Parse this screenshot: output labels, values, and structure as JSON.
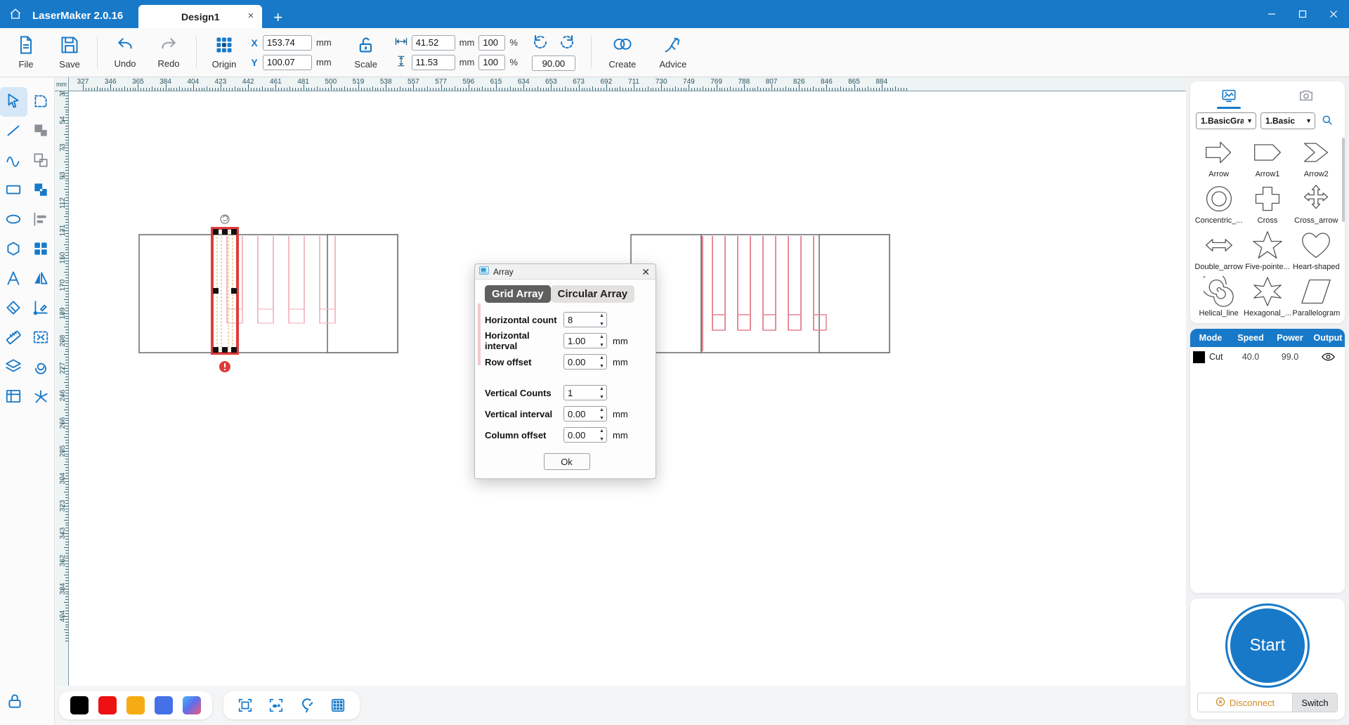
{
  "app": {
    "name": "LaserMaker 2.0.16",
    "home_icon": "home-icon",
    "tab": {
      "label": "Design1",
      "close": "×"
    },
    "new_tab": "+",
    "window": {
      "minimize": "─",
      "maximize": "☐",
      "close": "✕"
    }
  },
  "ribbon": {
    "file": {
      "label": "File",
      "icon": "file-icon"
    },
    "save": {
      "label": "Save",
      "icon": "save-icon"
    },
    "undo": {
      "label": "Undo",
      "icon": "undo-icon"
    },
    "redo": {
      "label": "Redo",
      "icon": "redo-icon"
    },
    "origin": {
      "label": "Origin",
      "icon": "origin-grid-icon"
    },
    "scale": {
      "label": "Scale",
      "icon": "unlock-icon"
    },
    "create": {
      "label": "Create",
      "icon": "create-icon"
    },
    "advice": {
      "label": "Advice",
      "icon": "advice-pen-icon"
    },
    "position": {
      "x_label": "X",
      "x_value": "153.74",
      "x_unit": "mm",
      "y_label": "Y",
      "y_value": "100.07",
      "y_unit": "mm"
    },
    "size": {
      "width_icon": "width-arrow-icon",
      "width_value": "41.52",
      "width_unit": "mm",
      "width_pct": "100",
      "pct_symbol": "%",
      "height_icon": "height-arrow-icon",
      "height_value": "11.53",
      "height_unit": "mm",
      "height_pct": "100"
    },
    "rotate": {
      "ccw_icon": "rotate-ccw-icon",
      "cw_icon": "rotate-cw-icon",
      "angle_value": "90.00"
    }
  },
  "toolrail": {
    "items": [
      {
        "name": "select-tool",
        "icon": "cursor-arrow-icon",
        "active": true
      },
      {
        "name": "node-edit-tool",
        "icon": "node-shape-icon",
        "active": false
      },
      {
        "name": "line-tool",
        "icon": "line-icon",
        "active": false
      },
      {
        "name": "union-tool",
        "icon": "union-shapes-icon",
        "active": false
      },
      {
        "name": "curve-tool",
        "icon": "curve-wave-icon",
        "active": false
      },
      {
        "name": "subtract-tool",
        "icon": "subtract-shapes-icon",
        "active": false
      },
      {
        "name": "rectangle-tool",
        "icon": "rectangle-icon",
        "active": false
      },
      {
        "name": "intersect-tool",
        "icon": "intersect-shapes-icon",
        "active": false
      },
      {
        "name": "ellipse-tool",
        "icon": "ellipse-icon",
        "active": false
      },
      {
        "name": "align-tool",
        "icon": "align-left-icon",
        "active": false
      },
      {
        "name": "polygon-tool",
        "icon": "hexagon-icon",
        "active": false
      },
      {
        "name": "array-tool",
        "icon": "grid-squares-icon",
        "active": false
      },
      {
        "name": "text-tool",
        "icon": "text-a-icon",
        "active": false
      },
      {
        "name": "mirror-tool",
        "icon": "mirror-icon",
        "active": false
      },
      {
        "name": "eraser-tool",
        "icon": "eraser-icon",
        "active": false
      },
      {
        "name": "measure-angle-tool",
        "icon": "angle-pen-icon",
        "active": false
      },
      {
        "name": "ruler-tool",
        "icon": "ruler-icon",
        "active": false
      },
      {
        "name": "distribute-tool",
        "icon": "distribute-icon",
        "active": false
      },
      {
        "name": "layers-tool",
        "icon": "layers-stack-icon",
        "active": false
      },
      {
        "name": "offset-tool",
        "icon": "offset-spiral-icon",
        "active": false
      },
      {
        "name": "table-tool",
        "icon": "table-icon",
        "active": false
      },
      {
        "name": "explode-tool",
        "icon": "explode-icon",
        "active": false
      }
    ],
    "lock": {
      "name": "lock-canvas",
      "icon": "lock-icon"
    }
  },
  "canvas": {
    "ruler_unit": "mm",
    "h_ticks": [
      "327",
      "346",
      "365",
      "384",
      "404",
      "423",
      "442",
      "461",
      "481",
      "500",
      "519",
      "538",
      "557",
      "577",
      "596",
      "615",
      "634",
      "653",
      "673",
      "692",
      "711",
      "730",
      "749",
      "769",
      "788",
      "807",
      "826",
      "846",
      "865",
      "884"
    ],
    "v_ticks": [
      "35",
      "54",
      "73",
      "93",
      "112",
      "131",
      "150",
      "170",
      "189",
      "208",
      "227",
      "246",
      "266",
      "285",
      "304",
      "323",
      "343",
      "362",
      "384",
      "404"
    ],
    "selection": {
      "rotate_handle": "rotate-handle-icon",
      "warning_badge": "warning-icon"
    }
  },
  "bottombar": {
    "colors": [
      {
        "name": "color-black",
        "hex": "#000000"
      },
      {
        "name": "color-red",
        "hex": "#ee1111"
      },
      {
        "name": "color-orange",
        "hex": "#f7ab12"
      },
      {
        "name": "color-blue",
        "hex": "#4571e8"
      },
      {
        "name": "color-gradient",
        "hex": "#7b8cf0"
      }
    ],
    "tools": [
      {
        "name": "select-frame-icon",
        "label": "frame"
      },
      {
        "name": "select-objects-icon",
        "label": "objects"
      },
      {
        "name": "magnet-snap-icon",
        "label": "magnet"
      },
      {
        "name": "grid-toggle-icon",
        "label": "grid"
      }
    ]
  },
  "library": {
    "tabs": [
      {
        "name": "tab-graphics",
        "icon": "image-picture-icon",
        "active": true
      },
      {
        "name": "tab-camera",
        "icon": "camera-icon",
        "active": false
      }
    ],
    "category": "1.BasicGra",
    "subcategory": "1.Basic",
    "search_icon": "search-icon",
    "shapes": [
      {
        "label": "Arrow",
        "icon": "arrow-right-block"
      },
      {
        "label": "Arrow1",
        "icon": "arrow-pentagon"
      },
      {
        "label": "Arrow2",
        "icon": "chevron-arrow"
      },
      {
        "label": "Concentric_...",
        "icon": "concentric-circles"
      },
      {
        "label": "Cross",
        "icon": "cross-plus"
      },
      {
        "label": "Cross_arrow",
        "icon": "four-way-arrow"
      },
      {
        "label": "Double_arrow",
        "icon": "double-headed-arrow"
      },
      {
        "label": "Five-pointe...",
        "icon": "five-pointed-star"
      },
      {
        "label": "Heart-shaped",
        "icon": "heart"
      },
      {
        "label": "Helical_line",
        "icon": "spiral"
      },
      {
        "label": "Hexagonal_...",
        "icon": "six-pointed-star"
      },
      {
        "label": "Parallelogram",
        "icon": "parallelogram"
      }
    ]
  },
  "layers": {
    "columns": [
      "Mode",
      "Speed",
      "Power",
      "Output"
    ],
    "rows": [
      {
        "color": "#000000",
        "mode": "Cut",
        "speed": "40.0",
        "power": "99.0",
        "output_icon": "eye-icon"
      }
    ]
  },
  "machine": {
    "start_label": "Start",
    "disconnect_label": "Disconnect",
    "disconnect_icon": "disconnect-circle-x-icon",
    "switch_label": "Switch"
  },
  "dialog": {
    "icon": "array-dialog-icon",
    "title": "Array",
    "close": "✕",
    "tabs": [
      {
        "label": "Grid Array",
        "active": true
      },
      {
        "label": "Circular Array",
        "active": false
      }
    ],
    "fields": [
      {
        "label": "Horizontal count",
        "value": "8",
        "unit": ""
      },
      {
        "label": "Horizontal interval",
        "value": "1.00",
        "unit": "mm"
      },
      {
        "label": "Row offset",
        "value": "0.00",
        "unit": "mm"
      },
      {
        "label": "Vertical Counts",
        "value": "1",
        "unit": ""
      },
      {
        "label": "Vertical interval",
        "value": "0.00",
        "unit": "mm"
      },
      {
        "label": "Column offset",
        "value": "0.00",
        "unit": "mm"
      }
    ],
    "ok_label": "Ok",
    "spinner_up": "▲",
    "spinner_down": "▼"
  }
}
